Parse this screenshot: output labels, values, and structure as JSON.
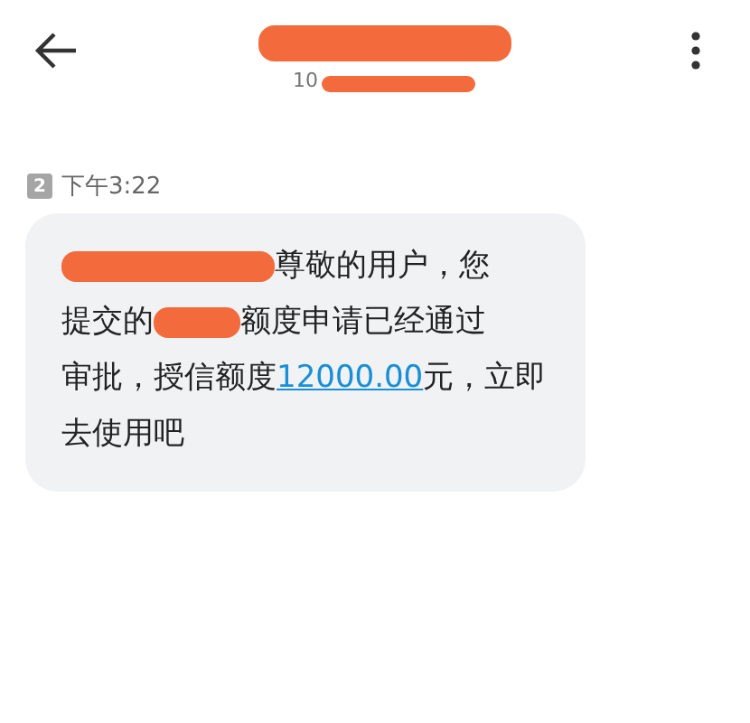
{
  "header": {
    "subtitle": "10"
  },
  "message": {
    "sim": "2",
    "time": "下午3:22",
    "lines": [
      [
        {
          "kind": "redacted"
        },
        {
          "kind": "text",
          "text": "尊敬的用户，您"
        }
      ],
      [
        {
          "kind": "text",
          "text": "提交的"
        },
        {
          "kind": "redacted"
        },
        {
          "kind": "text",
          "text": "额度申请已经通过"
        }
      ],
      [
        {
          "kind": "text",
          "text": "审批，授信额度"
        },
        {
          "kind": "link",
          "text": "12000.00"
        },
        {
          "kind": "text",
          "text": "元，立即"
        }
      ],
      [
        {
          "kind": "text",
          "text": "去使用吧"
        }
      ]
    ]
  }
}
